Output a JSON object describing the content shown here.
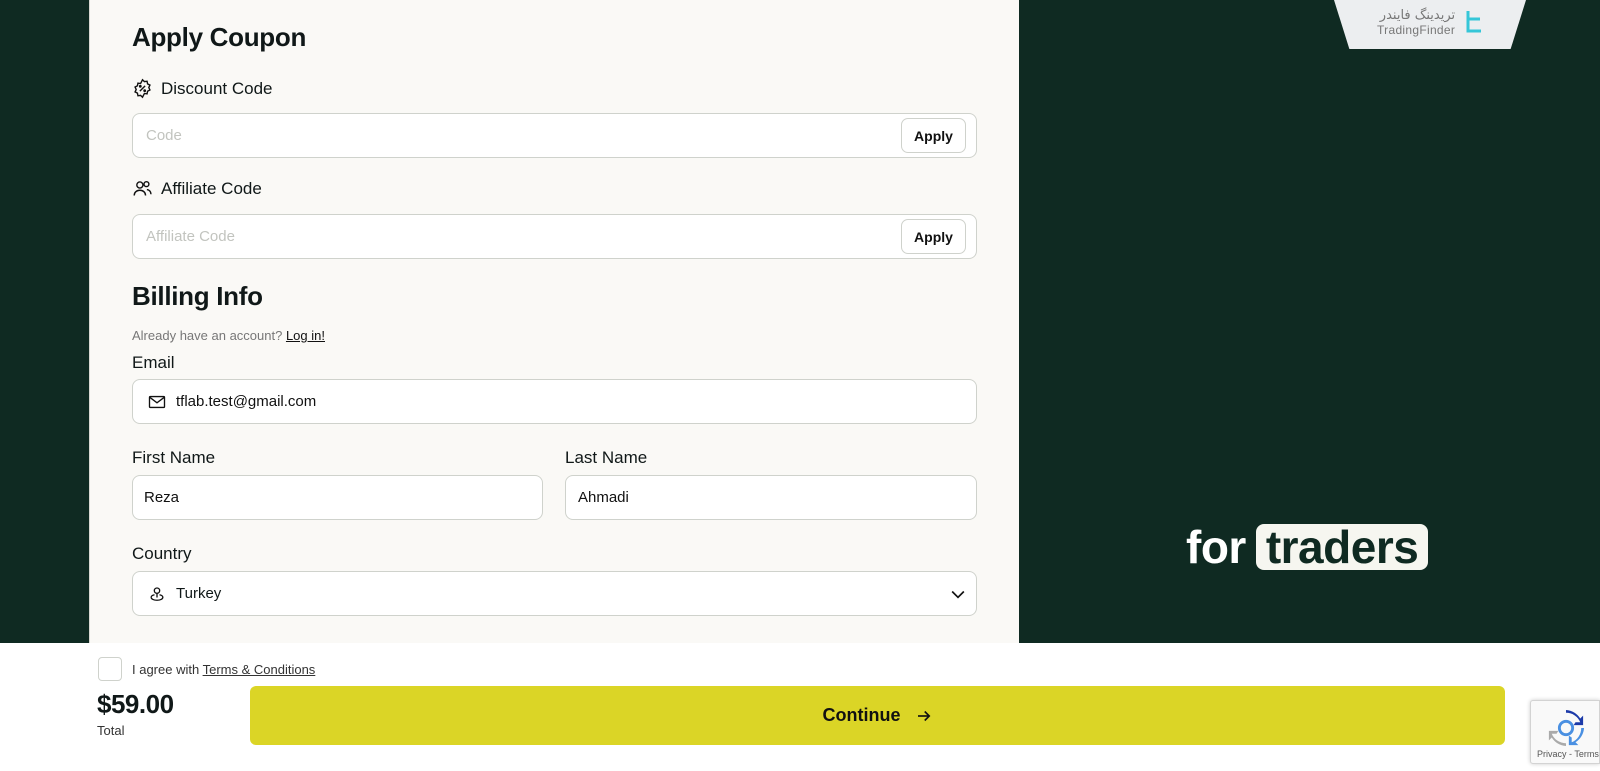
{
  "coupon": {
    "title": "Apply Coupon",
    "discount_label": "Discount Code",
    "discount_placeholder": "Code",
    "discount_value": "",
    "affiliate_label": "Affiliate Code",
    "affiliate_placeholder": "Affiliate Code",
    "affiliate_value": "",
    "apply_label": "Apply"
  },
  "billing": {
    "title": "Billing Info",
    "already_text": "Already have an account?",
    "login_link": "Log in!",
    "email_label": "Email",
    "email_value": "tflab.test@gmail.com",
    "first_name_label": "First Name",
    "first_name_value": "Reza",
    "last_name_label": "Last Name",
    "last_name_value": "Ahmadi",
    "country_label": "Country",
    "country_value": "Turkey"
  },
  "hero": {
    "prefix": "for",
    "highlight": "traders"
  },
  "brand": {
    "name_fa": "تریدینگ فایندر",
    "name_en": "TradingFinder",
    "logo_icon": "tradingfinder-logo-icon"
  },
  "footer": {
    "agree_text": "I agree with",
    "terms_link": "Terms & Conditions",
    "price": "$59.00",
    "total_label": "Total",
    "continue_label": "Continue",
    "recaptcha_links": "Privacy - Terms"
  },
  "colors": {
    "background": "#0f2a22",
    "panel": "#faf9f6",
    "accent": "#dbd526",
    "logo_accent": "#35c6d8"
  }
}
